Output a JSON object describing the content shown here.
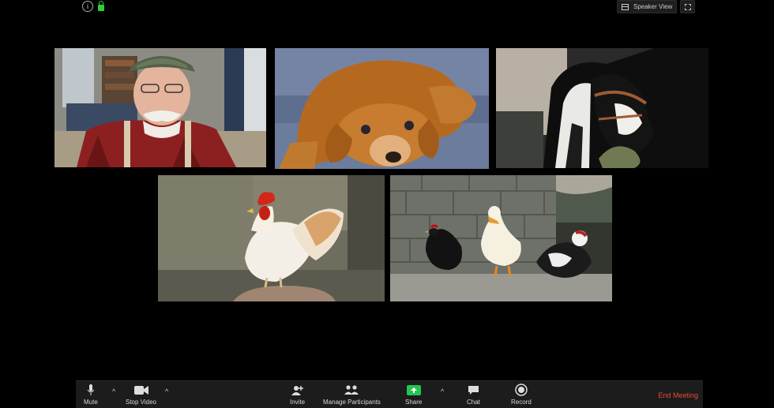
{
  "top_bar": {
    "view_label": "Speaker View"
  },
  "participants": [
    {
      "id": "farmer"
    },
    {
      "id": "dog"
    },
    {
      "id": "cow"
    },
    {
      "id": "rooster"
    },
    {
      "id": "poultry"
    }
  ],
  "toolbar": {
    "mute": "Mute",
    "stop_video": "Stop Video",
    "invite": "Invite",
    "manage_participants": "Manage Participants",
    "share": "Share",
    "chat": "Chat",
    "record": "Record",
    "end_meeting": "End Meeting"
  },
  "colors": {
    "share_green": "#23c552",
    "end_red": "#e8493b",
    "toolbar_bg": "#1c1c1c"
  },
  "icons": [
    "info-icon",
    "lock-icon",
    "speaker-view-grid-icon",
    "fullscreen-icon",
    "microphone-icon",
    "video-camera-icon",
    "add-person-icon",
    "participants-icon",
    "share-screen-icon",
    "chat-bubble-icon",
    "record-icon"
  ]
}
